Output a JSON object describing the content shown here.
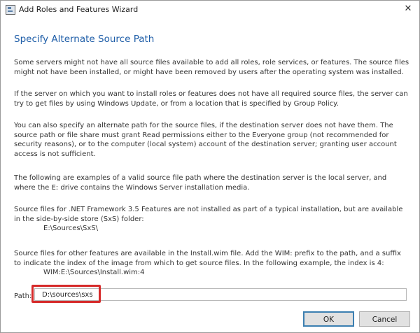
{
  "window": {
    "title": "Add Roles and Features Wizard",
    "close_glyph": "✕"
  },
  "page": {
    "heading": "Specify Alternate Source Path",
    "paragraphs": {
      "p1": "Some servers might not have all source files available to add all roles, role services, or features. The source files might not have been installed, or might have been removed by users after the operating system was installed.",
      "p2": "If the server on which you want to install roles or features does not have all required source files, the server can try to get files by using Windows Update, or from a location that is specified by Group Policy.",
      "p3": "You can also specify an alternate path for the source files, if the destination server does not have them. The source path or file share must grant Read permissions either to the Everyone group (not recommended for security reasons), or to the computer (local system) account of the destination server; granting user account access is not sufficient.",
      "p4": "The following are examples of a valid source file path where the destination server is the local server, and where the E: drive contains the Windows Server installation media.",
      "p5": "Source files for .NET Framework 3.5 Features are not installed as part of a typical installation, but are available in the side-by-side store (SxS) folder:",
      "p5_example": "E:\\Sources\\SxS\\",
      "p6": "Source files for other features are available in the Install.wim file. Add the WIM: prefix to the path, and a suffix to indicate the index of the image from which to get source files. In the following example, the index is 4:",
      "p6_example": "WIM:E:\\Sources\\Install.wim:4"
    }
  },
  "path": {
    "label": "Path:",
    "value": "D:\\sources\\sxs"
  },
  "buttons": {
    "ok": "OK",
    "cancel": "Cancel"
  },
  "colors": {
    "heading": "#1f5ea8",
    "highlight_border": "#d62a2a",
    "ok_border": "#3c7fb1"
  }
}
